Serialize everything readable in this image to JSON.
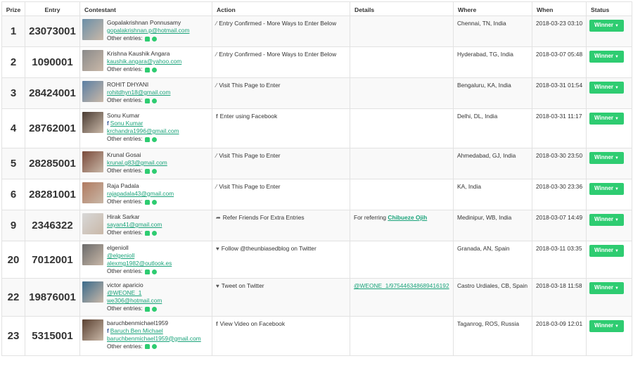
{
  "headers": {
    "prize": "Prize",
    "entry": "Entry",
    "contestant": "Contestant",
    "action": "Action",
    "details": "Details",
    "where": "Where",
    "when": "When",
    "status": "Status"
  },
  "other_entries_label": "Other entries:",
  "winner_label": "Winner",
  "icons": {
    "action_entry": "wand-icon",
    "action_visit": "wand-icon",
    "action_facebook": "facebook-icon",
    "action_refer": "share-icon",
    "action_twitter": "twitter-icon",
    "other_user": "person-icon",
    "other_globe": "globe-icon"
  },
  "colors": {
    "accent_green": "#2ecc71",
    "link_green": "#1aa37a",
    "facebook_blue": "#3b5998"
  },
  "rows": [
    {
      "prize": "1",
      "entry": "23073001",
      "name": "Gopalakrishnan Ponnusamy",
      "links": [
        "gopalakrishnan.p@hotmail.com"
      ],
      "action": "Entry Confirmed - More Ways to Enter Below",
      "action_glyph": "⁄",
      "details": "",
      "details_prefix": "",
      "details_link": "",
      "where": "Chennai, TN, India",
      "when": "2018-03-23 03:10"
    },
    {
      "prize": "2",
      "entry": "1090001",
      "name": "Krishna Kaushik Angara",
      "links": [
        "kaushik.angara@yahoo.com"
      ],
      "action": "Entry Confirmed - More Ways to Enter Below",
      "action_glyph": "⁄",
      "details": "",
      "details_prefix": "",
      "details_link": "",
      "where": "Hyderabad, TG, India",
      "when": "2018-03-07 05:48"
    },
    {
      "prize": "3",
      "entry": "28424001",
      "name": "ROHIT DHYANI",
      "links": [
        "rohitdhyn18@gmail.com"
      ],
      "action": "Visit This Page to Enter",
      "action_glyph": "⁄",
      "details": "",
      "details_prefix": "",
      "details_link": "",
      "where": "Bengaluru, KA, India",
      "when": "2018-03-31 01:54"
    },
    {
      "prize": "4",
      "entry": "28762001",
      "name": "Sonu Kumar",
      "fb_link": "Sonu Kumar",
      "links": [
        "krchandra1996@gmail.com"
      ],
      "action": "Enter using Facebook",
      "action_glyph": "f",
      "details": "",
      "details_prefix": "",
      "details_link": "",
      "where": "Delhi, DL, India",
      "when": "2018-03-31 11:17"
    },
    {
      "prize": "5",
      "entry": "28285001",
      "name": "Krunal Gosai",
      "links": [
        "krunal.g83@gmail.com"
      ],
      "action": "Visit This Page to Enter",
      "action_glyph": "⁄",
      "details": "",
      "details_prefix": "",
      "details_link": "",
      "where": "Ahmedabad, GJ, India",
      "when": "2018-03-30 23:50"
    },
    {
      "prize": "6",
      "entry": "28281001",
      "name": "Raja Padala",
      "links": [
        "rajapadala43@gmail.com"
      ],
      "action": "Visit This Page to Enter",
      "action_glyph": "⁄",
      "details": "",
      "details_prefix": "",
      "details_link": "",
      "where": "KA, India",
      "when": "2018-03-30 23:36"
    },
    {
      "prize": "9",
      "entry": "2346322",
      "name": "Hirak Sarkar",
      "links": [
        "sayan41@gmail.com"
      ],
      "action": "Refer Friends For Extra Entries",
      "action_glyph": "➦",
      "details": "",
      "details_prefix": "For referring",
      "details_link": "Chibueze Ojih",
      "where": "Medinipur, WB, India",
      "when": "2018-03-07 14:49"
    },
    {
      "prize": "20",
      "entry": "7012001",
      "name": "elgenioll",
      "links": [
        "@elgenioll",
        "alexmg1982@outlook.es"
      ],
      "action": "Follow @theunbiasedblog on Twitter",
      "action_glyph": "♥",
      "details": "",
      "details_prefix": "",
      "details_link": "",
      "where": "Granada, AN, Spain",
      "when": "2018-03-11 03:35"
    },
    {
      "prize": "22",
      "entry": "19876001",
      "name": "victor aparicio",
      "links": [
        "@WEONE_1",
        "we306@hotmail.com"
      ],
      "action": "Tweet on Twitter",
      "action_glyph": "♥",
      "details": "",
      "details_prefix": "",
      "details_link": "@WEONE_1/975446348689416192",
      "where": "Castro Urdiales, CB, Spain",
      "when": "2018-03-18 11:58"
    },
    {
      "prize": "23",
      "entry": "5315001",
      "name": "baruchbenmichael1959",
      "fb_link": "Baruch Ben Michael",
      "links": [
        "baruchbenmichael1959@gmail.com"
      ],
      "action": "View Video on Facebook",
      "action_glyph": "f",
      "details": "",
      "details_prefix": "",
      "details_link": "",
      "where": "Taganrog, ROS, Russia",
      "when": "2018-03-09 12:01"
    }
  ]
}
